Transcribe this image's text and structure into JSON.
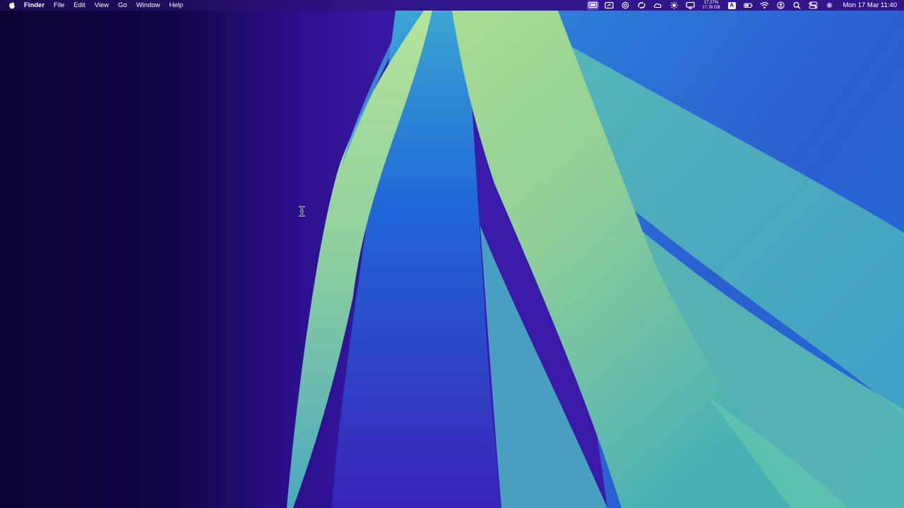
{
  "menubar": {
    "apple_icon": "apple-logo-icon",
    "items": [
      "Finder",
      "File",
      "Edit",
      "View",
      "Go",
      "Window",
      "Help"
    ],
    "status_icons": [
      "display-mirroring-icon",
      "screen-share-icon",
      "focus-target-icon",
      "link-sync-icon",
      "cloud-activity-icon",
      "brightness-gear-icon",
      "monitor-icon"
    ],
    "memory_stats": {
      "percent": "17.27%",
      "size": "17.78 GB"
    },
    "input_source": "A",
    "right_icons": [
      "battery-icon",
      "wifi-icon",
      "user-account-icon",
      "search-icon",
      "control-center-icon",
      "siri-icon"
    ],
    "clock": "Mon 17 Mar  11:40"
  },
  "desktop": {
    "cursor_icon": "text-cursor-icon",
    "colors": {
      "dark_purple": "#0e0538",
      "violet": "#3a1aa8",
      "blue": "#1f5fd6",
      "teal": "#56b8b0",
      "pale_green": "#a8d98c"
    }
  }
}
